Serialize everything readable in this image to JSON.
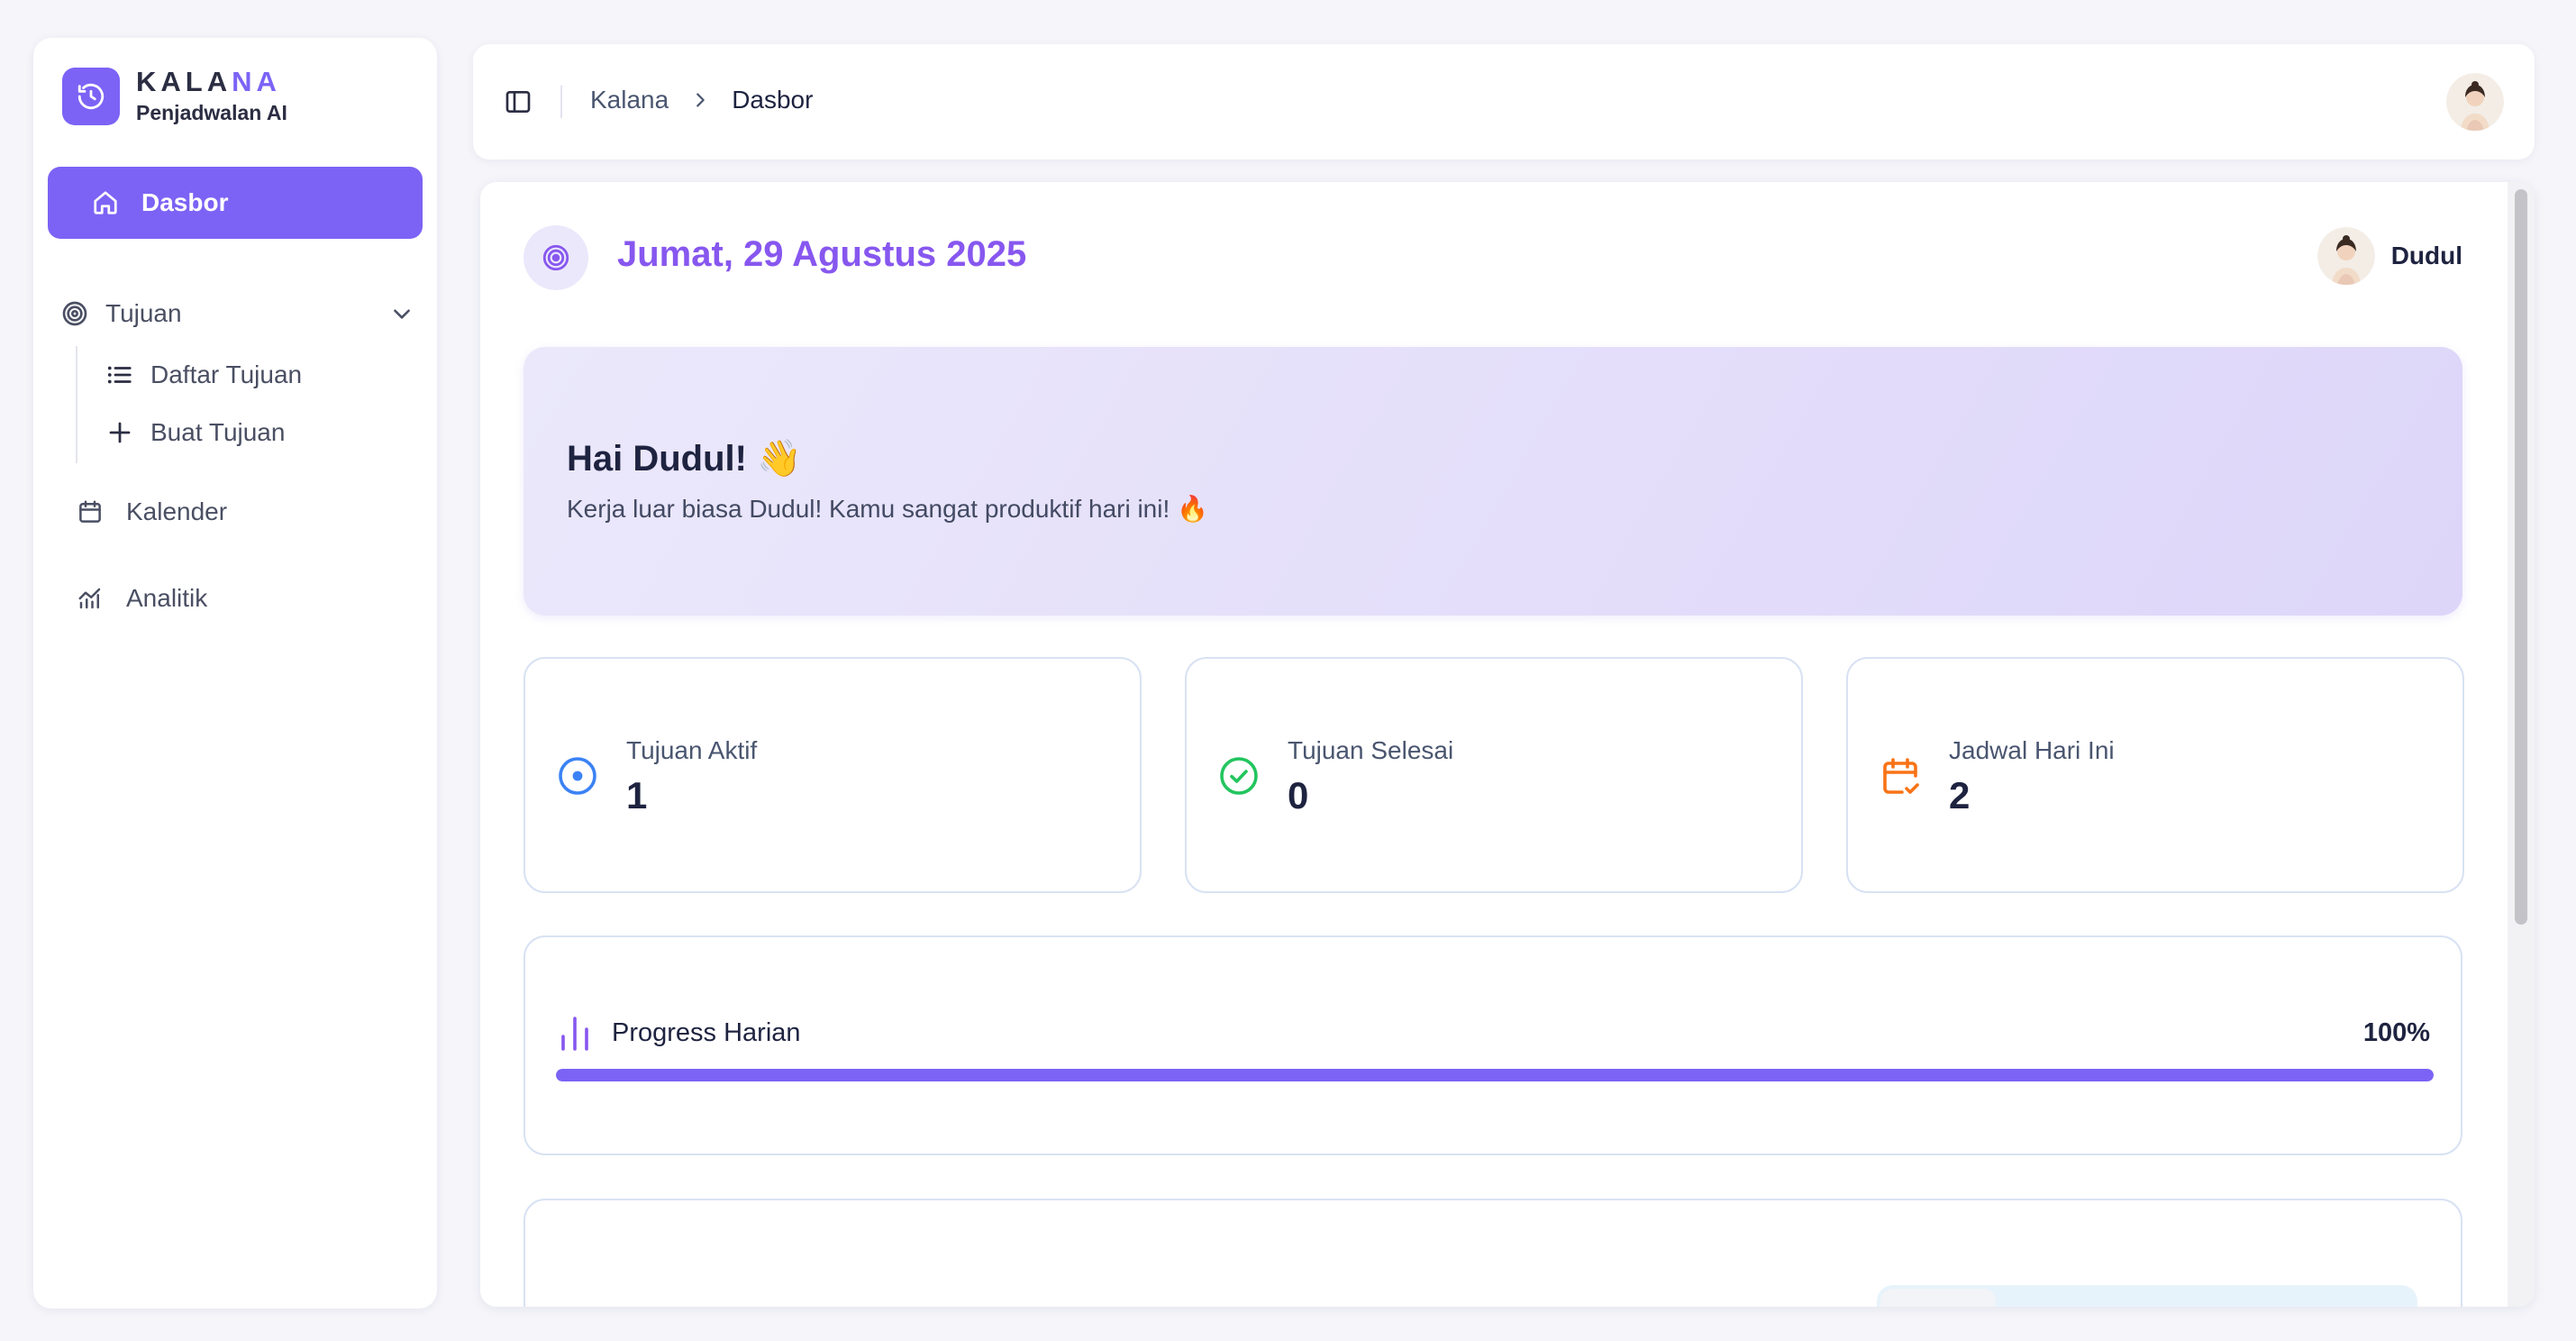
{
  "brand": {
    "name_main": "KALA",
    "name_accent": "NA",
    "subtitle": "Penjadwalan AI",
    "accent_color": "#7c63f5"
  },
  "sidebar": {
    "items": [
      {
        "label": "Dasbor",
        "icon": "home-icon",
        "active": true
      },
      {
        "label": "Tujuan",
        "icon": "target-icon",
        "expanded": true,
        "children": [
          {
            "label": "Daftar Tujuan",
            "icon": "list-icon"
          },
          {
            "label": "Buat Tujuan",
            "icon": "plus-icon"
          }
        ]
      },
      {
        "label": "Kalender",
        "icon": "calendar-icon"
      },
      {
        "label": "Analitik",
        "icon": "chart-icon"
      }
    ]
  },
  "topbar": {
    "breadcrumb": [
      "Kalana",
      "Dasbor"
    ]
  },
  "header": {
    "date": "Jumat, 29 Agustus 2025",
    "user_name": "Dudul"
  },
  "hero": {
    "title": "Hai Dudul! 👋",
    "subtitle": "Kerja luar biasa Dudul! Kamu sangat produktif hari ini! 🔥"
  },
  "stats": [
    {
      "label": "Tujuan Aktif",
      "value": "1",
      "icon": "target-dot-icon",
      "color": "#3b82f6"
    },
    {
      "label": "Tujuan Selesai",
      "value": "0",
      "icon": "check-circle-icon",
      "color": "#22c55e"
    },
    {
      "label": "Jadwal Hari Ini",
      "value": "2",
      "icon": "calendar-check-icon",
      "color": "#f97316"
    }
  ],
  "progress": {
    "label": "Progress Harian",
    "value_text": "100%",
    "fraction": 1.0,
    "color": "#7c63f5"
  }
}
